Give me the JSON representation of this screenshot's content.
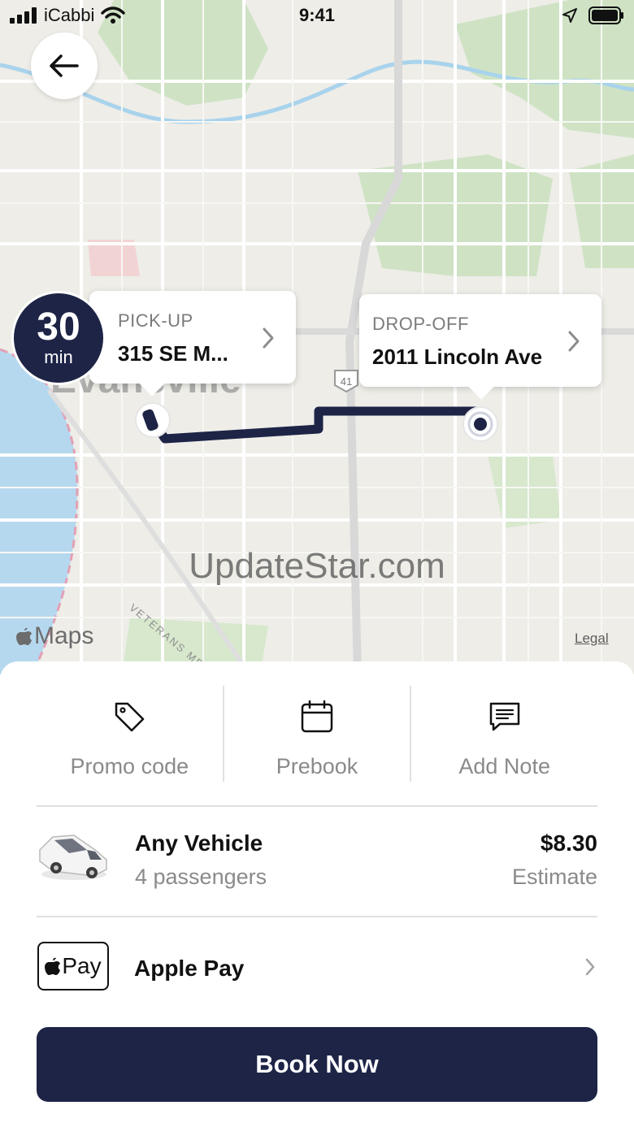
{
  "status_bar": {
    "carrier": "iCabbi",
    "time": "9:41"
  },
  "map": {
    "eta": {
      "value": "30",
      "unit": "min"
    },
    "pickup": {
      "label": "PICK-UP",
      "address": "315 SE M..."
    },
    "dropoff": {
      "label": "DROP-OFF",
      "address": "2011 Lincoln Ave"
    },
    "city_label": "Evansville",
    "road_label": "VETERANS MEMORIAL",
    "highway_shield": "41",
    "attribution": "Maps",
    "legal": "Legal",
    "watermark": "UpdateStar.com",
    "route_color": "#1d2446"
  },
  "actions": [
    {
      "label": "Promo code",
      "icon": "tag-icon"
    },
    {
      "label": "Prebook",
      "icon": "calendar-icon"
    },
    {
      "label": "Add Note",
      "icon": "note-icon"
    }
  ],
  "vehicle": {
    "name": "Any Vehicle",
    "capacity": "4 passengers",
    "price": "$8.30",
    "price_note": "Estimate"
  },
  "payment": {
    "badge": "Pay",
    "method": "Apple Pay"
  },
  "book_button": {
    "label": "Book Now"
  },
  "colors": {
    "brand": "#1d2446"
  }
}
